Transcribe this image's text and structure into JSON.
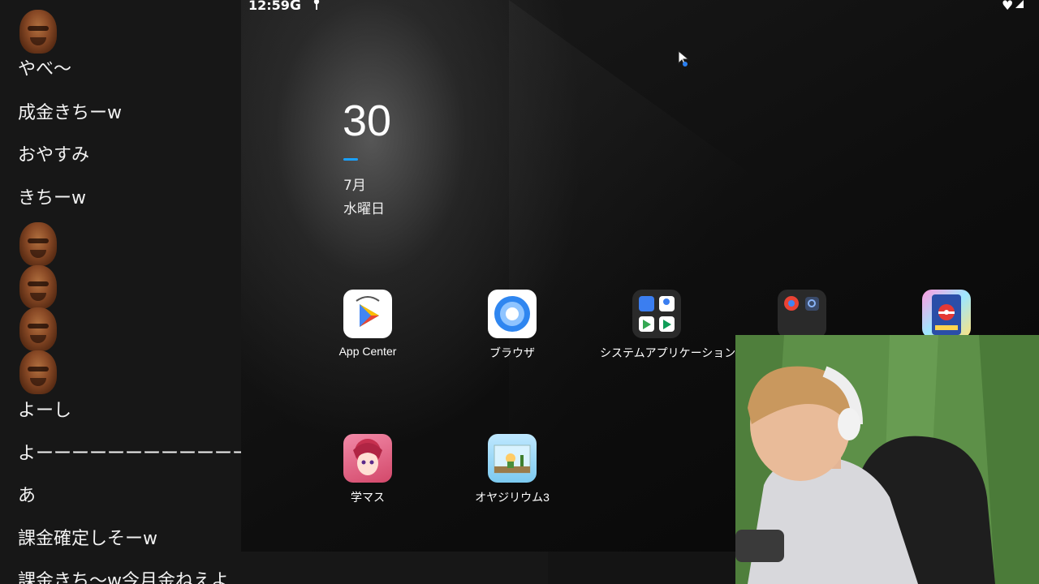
{
  "chat": {
    "messages": [
      {
        "type": "stamp"
      },
      {
        "type": "text",
        "text": "やべ～"
      },
      {
        "type": "text",
        "text": "成金きちーw"
      },
      {
        "type": "text",
        "text": "おやすみ"
      },
      {
        "type": "text",
        "text": "きちーw"
      },
      {
        "type": "stamp"
      },
      {
        "type": "stamp"
      },
      {
        "type": "stamp"
      },
      {
        "type": "stamp"
      },
      {
        "type": "text",
        "text": "よーし"
      },
      {
        "type": "text",
        "text": "よーーーーーーーーーーーー"
      },
      {
        "type": "text",
        "text": "あ"
      },
      {
        "type": "text",
        "text": "課金確定しそーw"
      },
      {
        "type": "text",
        "text": "課金きち～w今月金ねえよ"
      }
    ]
  },
  "status_bar": {
    "time": "12:59",
    "google_glyph": "G"
  },
  "date_widget": {
    "day": "30",
    "month": "7月",
    "weekday": "水曜日"
  },
  "apps": [
    {
      "label": "App Center",
      "icon": "play-store-icon"
    },
    {
      "label": "ブラウザ",
      "icon": "browser-icon"
    },
    {
      "label": "システムアプリケーション",
      "icon": "system-apps-folder-icon"
    },
    {
      "label": "",
      "icon": "google-folder-icon"
    },
    {
      "label": "",
      "icon": "pokemon-card-icon"
    },
    {
      "label": "学マス",
      "icon": "gakumas-icon"
    },
    {
      "label": "オヤジリウム3",
      "icon": "oyajirium-icon"
    }
  ],
  "colors": {
    "accent": "#1aa1ff",
    "chat_bg": "#171717",
    "screen_bg": "#0e0e0e",
    "webcam_green": "#5f924a"
  }
}
